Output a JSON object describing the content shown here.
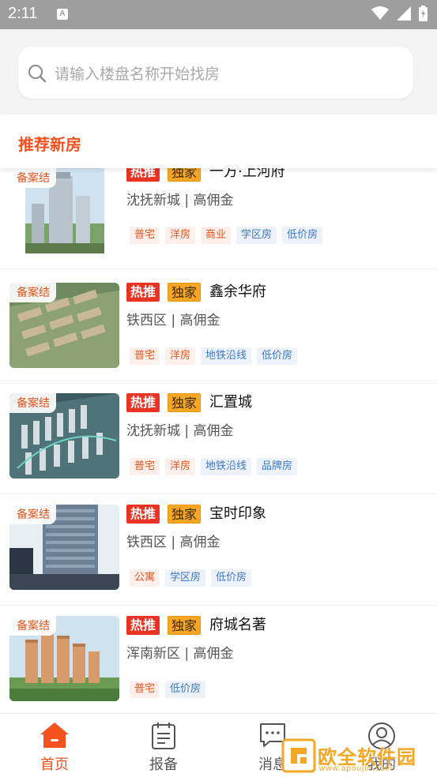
{
  "status_bar": {
    "time": "2:11"
  },
  "search": {
    "placeholder": "请输入楼盘名称开始找房"
  },
  "section": {
    "title": "推荐新房"
  },
  "listings": [
    {
      "badge": "备案结",
      "hot": "热推",
      "exclusive": "独家",
      "name": "一方·上河府",
      "district": "沈抚新城",
      "commission": "高佣金",
      "tags": [
        [
          "普宅",
          "red"
        ],
        [
          "洋房",
          "red"
        ],
        [
          "商业",
          "red"
        ],
        [
          "学区房",
          "blue"
        ],
        [
          "低价房",
          "blue"
        ]
      ]
    },
    {
      "badge": "备案结",
      "hot": "热推",
      "exclusive": "独家",
      "name": "鑫余华府",
      "district": "铁西区",
      "commission": "高佣金",
      "tags": [
        [
          "普宅",
          "red"
        ],
        [
          "洋房",
          "red"
        ],
        [
          "地铁沿线",
          "blue"
        ],
        [
          "低价房",
          "blue"
        ]
      ]
    },
    {
      "badge": "备案结",
      "hot": "热推",
      "exclusive": "独家",
      "name": "汇置城",
      "district": "沈抚新城",
      "commission": "高佣金",
      "tags": [
        [
          "普宅",
          "red"
        ],
        [
          "洋房",
          "red"
        ],
        [
          "地铁沿线",
          "blue"
        ],
        [
          "品牌房",
          "blue"
        ]
      ]
    },
    {
      "badge": "备案结",
      "hot": "热推",
      "exclusive": "独家",
      "name": "宝时印象",
      "district": "铁西区",
      "commission": "高佣金",
      "tags": [
        [
          "公寓",
          "red"
        ],
        [
          "学区房",
          "blue"
        ],
        [
          "低价房",
          "blue"
        ]
      ]
    },
    {
      "badge": "备案结",
      "hot": "热推",
      "exclusive": "独家",
      "name": "府城名著",
      "district": "浑南新区",
      "commission": "高佣金",
      "tags": [
        [
          "普宅",
          "red"
        ],
        [
          "低价房",
          "blue"
        ]
      ]
    }
  ],
  "tabbar": [
    {
      "label": "首页",
      "icon": "home-icon",
      "active": true
    },
    {
      "label": "报备",
      "icon": "clipboard-icon",
      "active": false
    },
    {
      "label": "消息",
      "icon": "message-icon",
      "active": false
    },
    {
      "label": "我的",
      "icon": "user-icon",
      "active": false
    }
  ],
  "watermark": {
    "text": "欧全软件园",
    "url": "www.apoujin.com"
  },
  "colors": {
    "accent": "#f4511e",
    "hot": "#ea3323",
    "exclusive": "#f5a623",
    "tag_blue": "#3a78c8"
  }
}
